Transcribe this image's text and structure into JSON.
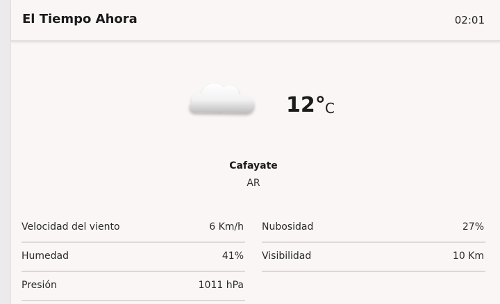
{
  "header": {
    "title": "El Tiempo Ahora",
    "time": "02:01"
  },
  "current": {
    "icon": "cloud-icon",
    "temperature": "12°",
    "unit": "C",
    "city": "Cafayate",
    "country": "AR"
  },
  "details": {
    "wind_label": "Velocidad del viento",
    "wind_value": "6 Km/h",
    "cloudiness_label": "Nubosidad",
    "cloudiness_value": "27%",
    "humidity_label": "Humedad",
    "humidity_value": "41%",
    "visibility_label": "Visibilidad",
    "visibility_value": "10 Km",
    "pressure_label": "Presión",
    "pressure_value": "1011 hPa"
  }
}
